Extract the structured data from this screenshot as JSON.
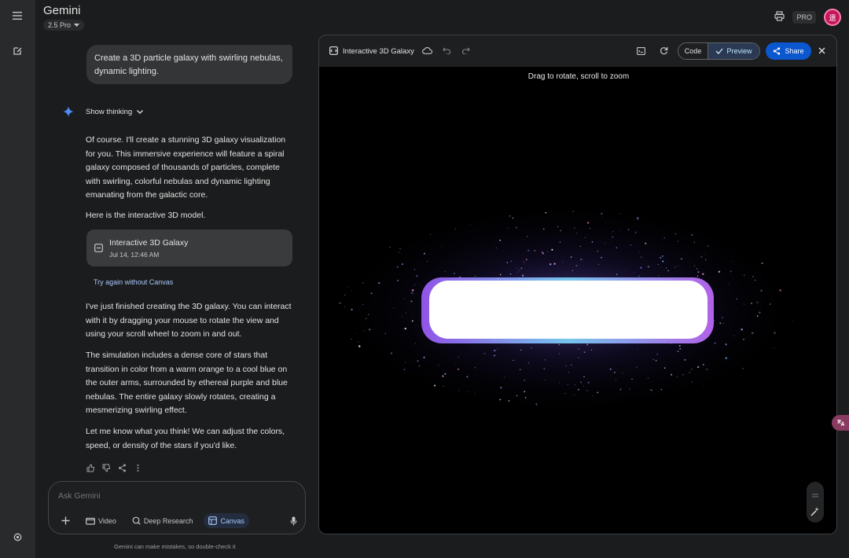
{
  "app": {
    "title": "Gemini",
    "model": "2.5 Pro",
    "pro_badge": "PRO",
    "avatar_initial": "遗"
  },
  "icons": {
    "menu": "menu-icon",
    "new_chat": "edit-icon",
    "settings": "gear-icon",
    "print": "print-icon",
    "sparkle": "sparkle-icon"
  },
  "conversation": {
    "user_message": "Create a 3D particle galaxy with swirling nebulas, dynamic lighting.",
    "show_thinking_label": "Show thinking",
    "paragraphs": [
      "Of course. I'll create a stunning 3D galaxy visualization for you. This immersive experience will feature a spiral galaxy composed of thousands of particles, complete with swirling, colorful nebulas and dynamic lighting emanating from the galactic core.",
      "Here is the interactive 3D model.",
      "I've just finished creating the 3D galaxy. You can interact with it by dragging your mouse to rotate the view and using your scroll wheel to zoom in and out.",
      "The simulation includes a dense core of stars that transition in color from a warm orange to a cool blue on the outer arms, surrounded by ethereal purple and blue nebulas. The entire galaxy slowly rotates, creating a mesmerizing swirling effect.",
      "Let me know what you think! We can adjust the colors, speed, or density of the stars if you'd like."
    ],
    "artifact": {
      "title": "Interactive 3D Galaxy",
      "date": "Jul 14, 12:46 AM"
    },
    "try_again_label": "Try again without Canvas"
  },
  "composer": {
    "placeholder": "Ask Gemini",
    "tools": {
      "video": "Video",
      "deep_research": "Deep Research",
      "canvas": "Canvas"
    },
    "disclaimer": "Gemini can make mistakes, so double-check it"
  },
  "canvas": {
    "title": "Interactive 3D Galaxy",
    "code_label": "Code",
    "preview_label": "Preview",
    "share_label": "Share",
    "hint": "Drag to rotate, scroll to zoom"
  },
  "colors": {
    "accent": "#0b57d0",
    "link": "#a8c7fa",
    "preview_bg": "#2b3953"
  }
}
